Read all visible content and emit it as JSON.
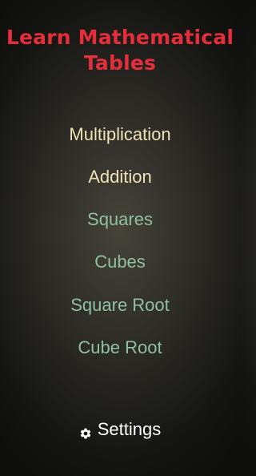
{
  "app": {
    "title_line1": "Learn Mathematical",
    "title_line2": "Tables"
  },
  "menu": {
    "items": [
      {
        "label": "Multiplication"
      },
      {
        "label": "Addition"
      },
      {
        "label": "Squares"
      },
      {
        "label": "Cubes"
      },
      {
        "label": "Square Root"
      },
      {
        "label": "Cube Root"
      }
    ]
  },
  "settings": {
    "label": "Settings",
    "icon": "gear-icon"
  },
  "colors": {
    "title": "#e42e3c",
    "primary_item": "#efe3b5",
    "secondary_item": "#8fc0a1",
    "settings_text": "#ffffff"
  }
}
